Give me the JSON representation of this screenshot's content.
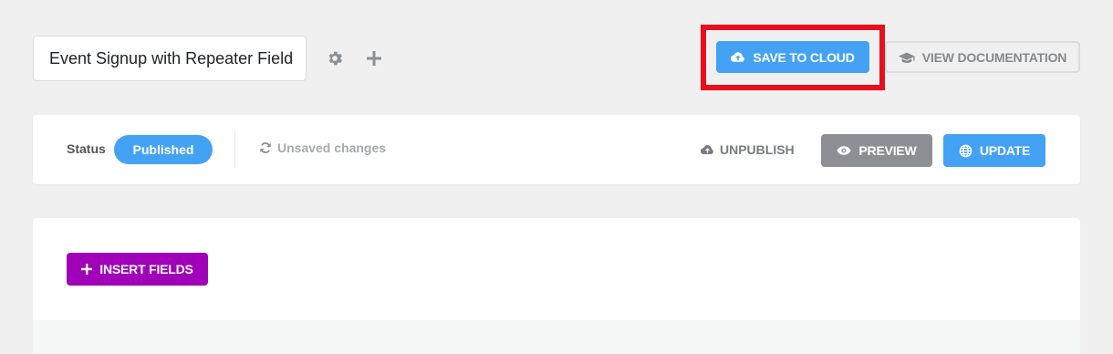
{
  "form": {
    "title": "Event Signup with Repeater Field"
  },
  "toolbar": {
    "save_to_cloud": "SAVE TO CLOUD",
    "view_documentation": "VIEW DOCUMENTATION"
  },
  "status_bar": {
    "status_label": "Status",
    "status_value": "Published",
    "unsaved": "Unsaved changes",
    "unpublish": "UNPUBLISH",
    "preview": "PREVIEW",
    "update": "UPDATE"
  },
  "editor": {
    "insert_fields": "INSERT FIELDS"
  },
  "icons": {
    "settings": "gear-icon",
    "add": "plus-icon",
    "cloud_upload": "cloud-upload-icon",
    "documentation": "graduation-cap-icon",
    "refresh": "refresh-icon",
    "eye": "eye-icon",
    "globe": "globe-icon"
  },
  "colors": {
    "primary": "#43a2f4",
    "secondary_gray": "#8c8f94",
    "insert_purple": "#a000b8",
    "highlight_red": "#e8101e"
  }
}
